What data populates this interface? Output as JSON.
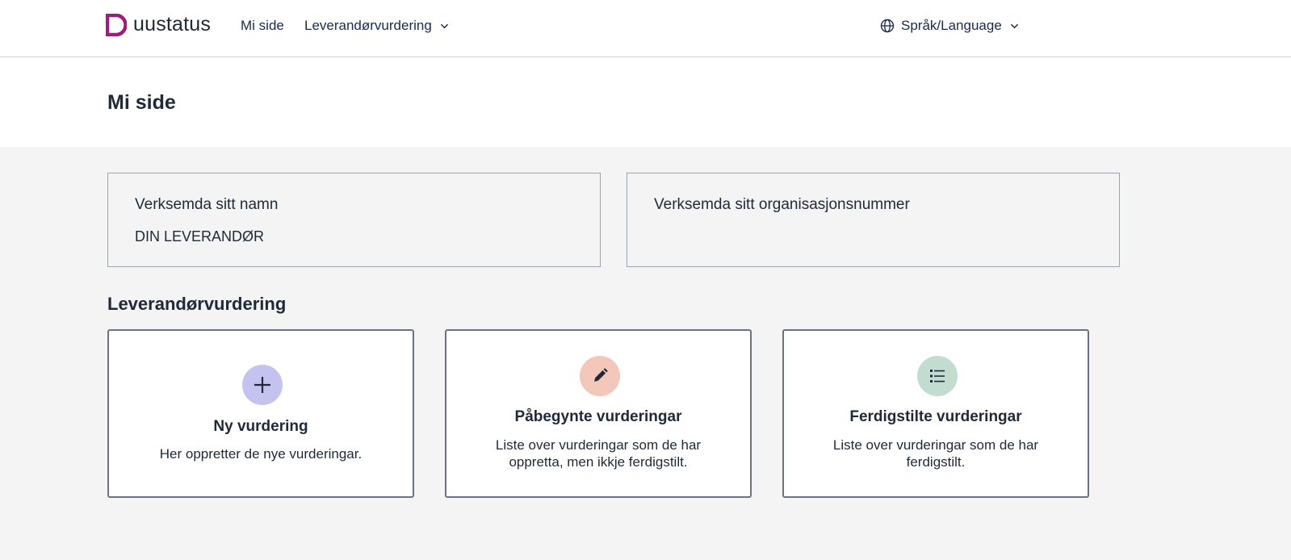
{
  "header": {
    "logo_text": "uustatus",
    "nav_mi_side": "Mi side",
    "nav_leverandor": "Leverandørvurdering",
    "language": "Språk/Language"
  },
  "page": {
    "title": "Mi side"
  },
  "info": {
    "name_label": "Verksemda sitt namn",
    "name_value": "DIN LEVERANDØR",
    "org_label": "Verksemda sitt organisasjonsnummer",
    "org_value": ""
  },
  "section": {
    "title": "Leverandørvurdering"
  },
  "cards": [
    {
      "title": "Ny vurdering",
      "description": "Her oppretter de nye vurderingar.",
      "icon": "plus-icon",
      "color": "#c4c3ef"
    },
    {
      "title": "Påbegynte vurderingar",
      "description": "Liste over vurderingar som de har oppretta, men ikkje ferdigstilt.",
      "icon": "pencil-icon",
      "color": "#f3c7b9"
    },
    {
      "title": "Ferdigstilte vurderingar",
      "description": "Liste over vurderingar som de har ferdigstilt.",
      "icon": "list-icon",
      "color": "#c2ddd0"
    }
  ],
  "colors": {
    "brand": "#9b1e7a",
    "nav_text": "#1a2b4c",
    "background": "#f3f4f3"
  }
}
